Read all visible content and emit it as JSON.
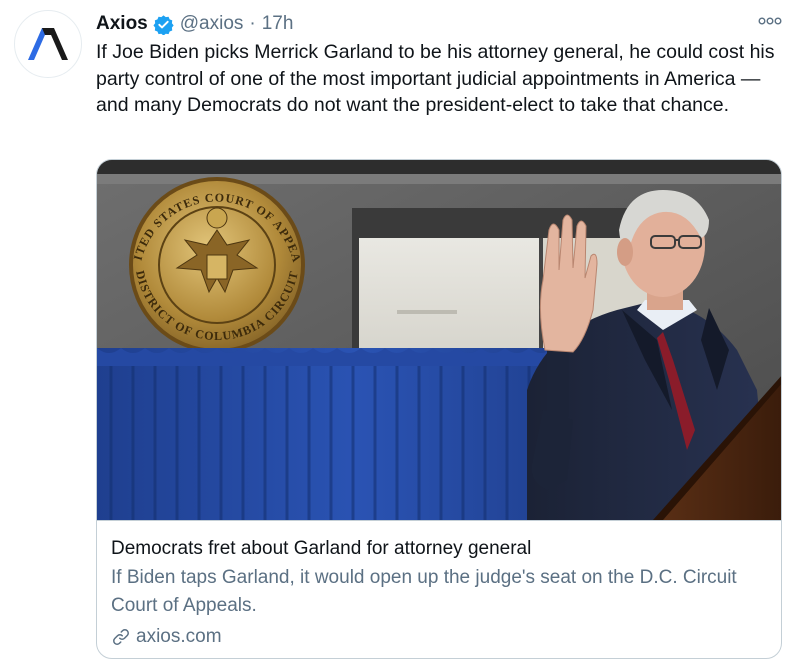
{
  "tweet": {
    "author": {
      "display_name": "Axios",
      "handle": "@axios",
      "verified": true
    },
    "separator": "·",
    "time": "17h",
    "text": "If Joe Biden picks Merrick Garland to be his attorney general, he could cost his party control of one of the most important judicial appointments in America — and many Democrats do not want the president-elect to take that chance."
  },
  "card": {
    "title": "Democrats fret about Garland for attorney general",
    "description": "If Biden taps Garland, it would open up the judge's seat on the D.C. Circuit Court of Appeals.",
    "domain": "axios.com",
    "image": {
      "seal_text_top": "UNITED STATES COURT OF APPEALS",
      "seal_text_bottom": "DISTRICT OF COLUMBIA CIRCUIT"
    }
  },
  "colors": {
    "text_primary": "#0f1419",
    "text_secondary": "#5b7083",
    "verified_blue": "#1da1f2",
    "brand_dark": "#1a1a1a",
    "brand_blue": "#2d6be4",
    "card_border": "#c4cfd6"
  },
  "icons": {
    "avatar": "axios-logo-icon",
    "verified": "verified-badge-icon",
    "more": "more-options-icon",
    "link": "link-icon"
  }
}
